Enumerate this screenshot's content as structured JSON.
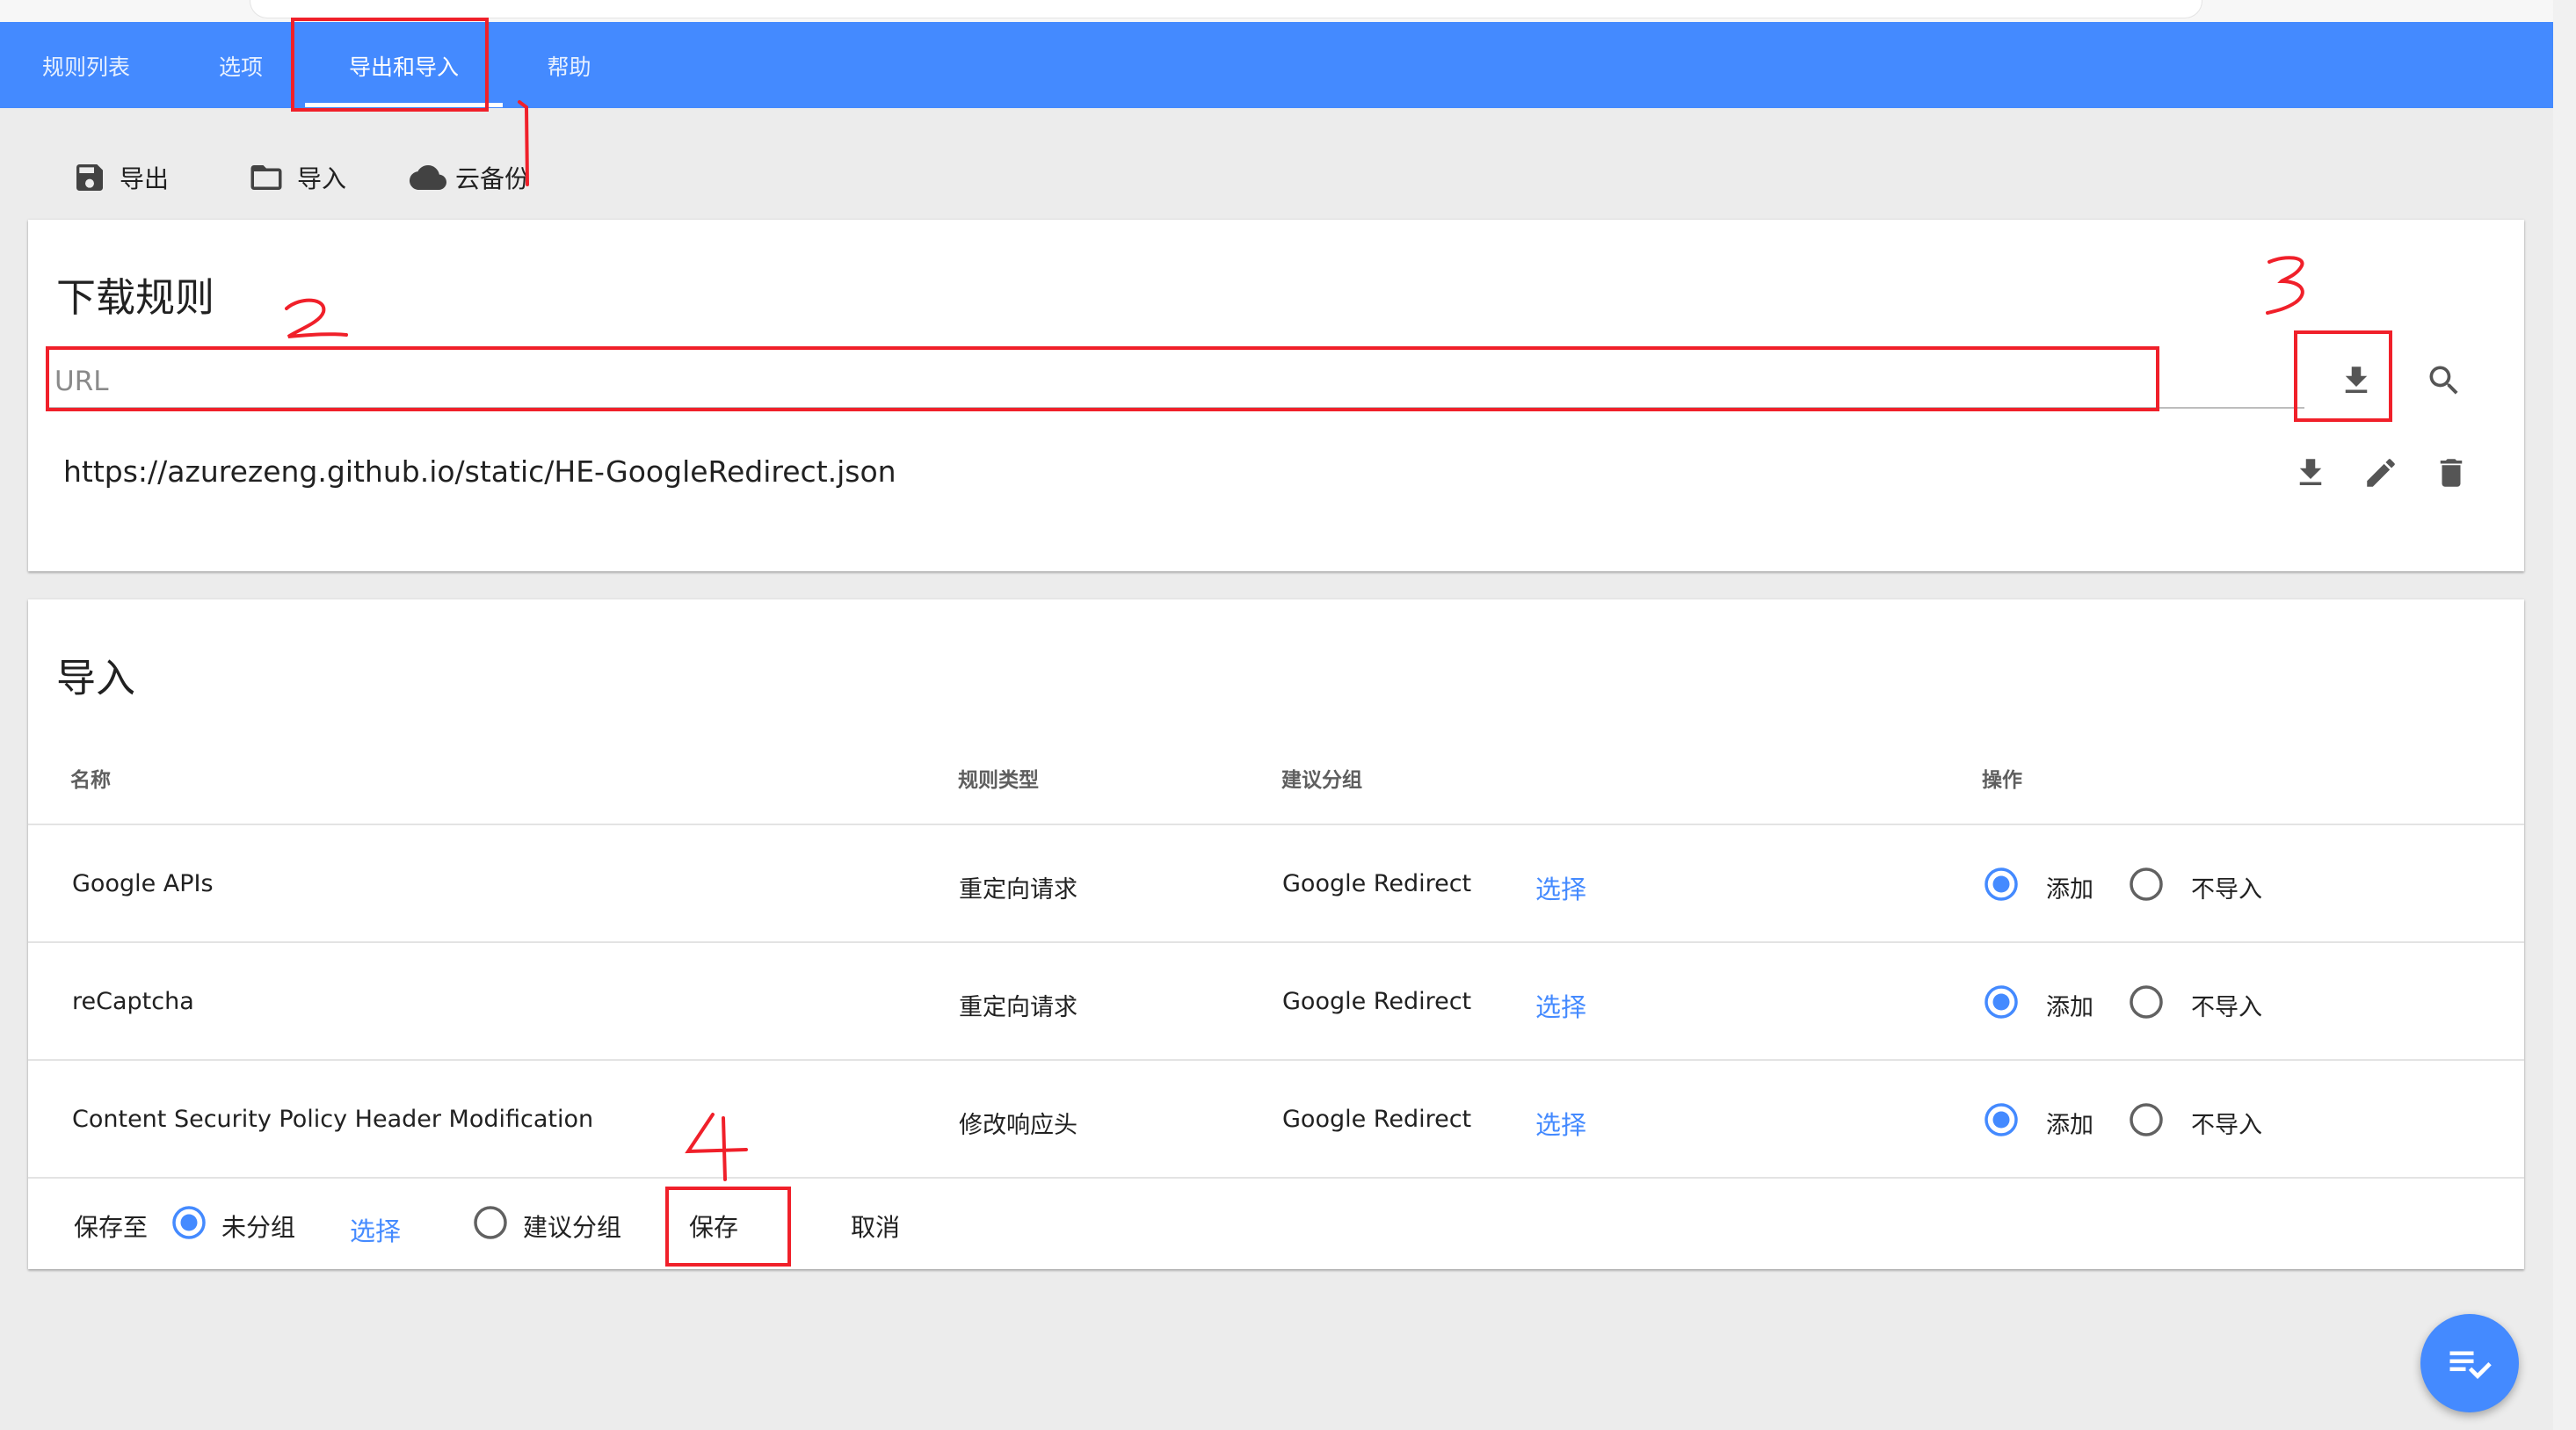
{
  "nav": {
    "tabs": [
      {
        "label": "规则列表"
      },
      {
        "label": "选项"
      },
      {
        "label": "导出和导入"
      },
      {
        "label": "帮助"
      }
    ],
    "active_tab": "导出和导入"
  },
  "toolbar": {
    "export_label": "导出",
    "import_label": "导入",
    "cloud_label": "云备份"
  },
  "download": {
    "title": "下载规则",
    "url_placeholder": "URL",
    "rules": [
      {
        "url": "https://azurezeng.github.io/static/HE-GoogleRedirect.json"
      }
    ]
  },
  "import": {
    "title": "导入",
    "columns": [
      "名称",
      "规则类型",
      "建议分组",
      "操作"
    ],
    "rows": [
      {
        "name": "Google APIs",
        "type": "重定向请求",
        "group": "Google Redirect",
        "select": "选择",
        "add": "添加",
        "skip": "不导入"
      },
      {
        "name": "reCaptcha",
        "type": "重定向请求",
        "group": "Google Redirect",
        "select": "选择",
        "add": "添加",
        "skip": "不导入"
      },
      {
        "name": "Content Security Policy Header Modification",
        "type": "修改响应头",
        "group": "Google Redirect",
        "select": "选择",
        "add": "添加",
        "skip": "不导入"
      }
    ],
    "footer": {
      "save_to": "保存至",
      "ungrouped": "未分组",
      "select": "选择",
      "suggested": "建议分组",
      "save": "保存",
      "cancel": "取消"
    }
  },
  "annotations": [
    "1",
    "2",
    "3",
    "4"
  ],
  "colors": {
    "primary": "#448aff",
    "annotation": "#f0202a"
  },
  "icons": [
    "save-icon",
    "folder-icon",
    "cloud-icon",
    "download-icon",
    "search-icon",
    "edit-icon",
    "delete-icon",
    "playlist-check-icon"
  ]
}
